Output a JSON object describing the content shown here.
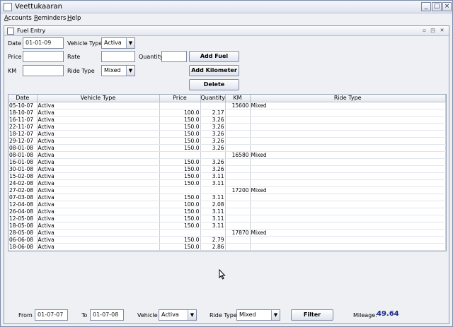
{
  "app": {
    "title": "Veettukaaran"
  },
  "window_buttons": {
    "minimize": "_",
    "maximize": "□",
    "close": "×"
  },
  "menu": [
    {
      "label": "Accounts"
    },
    {
      "label": "Reminders"
    },
    {
      "label": "Help"
    }
  ],
  "panel": {
    "title": "Fuel Entry"
  },
  "form": {
    "date_label": "Date",
    "date_value": "01-01-09",
    "vehicle_type_label": "Vehicle Type",
    "vehicle_type_value": "Activa",
    "price_label": "Price",
    "price_value": "",
    "rate_label": "Rate",
    "rate_value": "",
    "quantity_label": "Quantity",
    "quantity_value": "",
    "km_label": "KM",
    "km_value": "",
    "ride_type_label": "Ride Type",
    "ride_type_value": "Mixed",
    "add_fuel": "Add Fuel",
    "add_km": "Add Kilometer",
    "delete": "Delete"
  },
  "table": {
    "columns": [
      "Date",
      "Vehicle Type",
      "Price",
      "Quantity",
      "KM",
      "Ride Type"
    ],
    "rows": [
      [
        "05-10-07",
        "Activa",
        "",
        "",
        "15600",
        "Mixed"
      ],
      [
        "18-10-07",
        "Activa",
        "100.0",
        "2.17",
        "",
        ""
      ],
      [
        "16-11-07",
        "Activa",
        "150.0",
        "3.26",
        "",
        ""
      ],
      [
        "22-11-07",
        "Activa",
        "150.0",
        "3.26",
        "",
        ""
      ],
      [
        "18-12-07",
        "Activa",
        "150.0",
        "3.26",
        "",
        ""
      ],
      [
        "29-12-07",
        "Activa",
        "150.0",
        "3.26",
        "",
        ""
      ],
      [
        "08-01-08",
        "Activa",
        "150.0",
        "3.26",
        "",
        ""
      ],
      [
        "08-01-08",
        "Activa",
        "",
        "",
        "16580",
        "Mixed"
      ],
      [
        "16-01-08",
        "Activa",
        "150.0",
        "3.26",
        "",
        ""
      ],
      [
        "30-01-08",
        "Activa",
        "150.0",
        "3.26",
        "",
        ""
      ],
      [
        "15-02-08",
        "Activa",
        "150.0",
        "3.11",
        "",
        ""
      ],
      [
        "24-02-08",
        "Activa",
        "150.0",
        "3.11",
        "",
        ""
      ],
      [
        "27-02-08",
        "Activa",
        "",
        "",
        "17200",
        "Mixed"
      ],
      [
        "07-03-08",
        "Activa",
        "150.0",
        "3.11",
        "",
        ""
      ],
      [
        "12-04-08",
        "Activa",
        "100.0",
        "2.08",
        "",
        ""
      ],
      [
        "26-04-08",
        "Activa",
        "150.0",
        "3.11",
        "",
        ""
      ],
      [
        "12-05-08",
        "Activa",
        "150.0",
        "3.11",
        "",
        ""
      ],
      [
        "18-05-08",
        "Activa",
        "150.0",
        "3.11",
        "",
        ""
      ],
      [
        "28-05-08",
        "Activa",
        "",
        "",
        "17870",
        "Mixed"
      ],
      [
        "06-06-08",
        "Activa",
        "150.0",
        "2.79",
        "",
        ""
      ],
      [
        "18-06-08",
        "Activa",
        "150.0",
        "2.86",
        "",
        ""
      ]
    ]
  },
  "filter": {
    "from_label": "From",
    "from_value": "01-07-07",
    "to_label": "To",
    "to_value": "01-07-08",
    "vehicle_label": "Vehicle",
    "vehicle_value": "Activa",
    "ride_type_label": "Ride Type",
    "ride_type_value": "Mixed",
    "filter_button": "Filter",
    "mileage_label": "Mileage:",
    "mileage_value": "49.64"
  }
}
